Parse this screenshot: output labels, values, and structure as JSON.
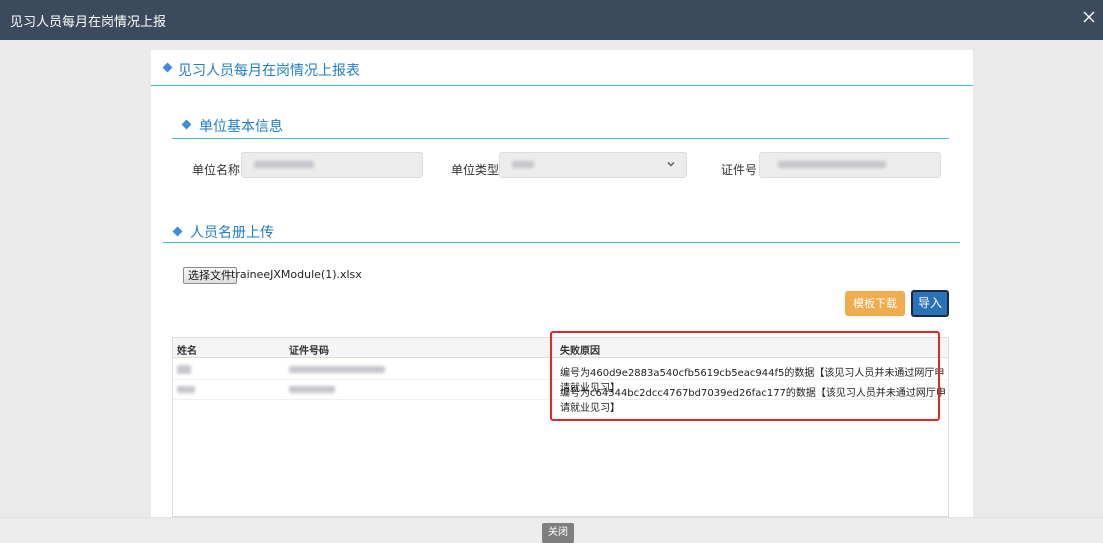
{
  "window": {
    "title": "见习人员每月在岗情况上报"
  },
  "panel": {
    "title": "见习人员每月在岗情况上报表"
  },
  "unit_info": {
    "section_title": "单位基本信息",
    "name_label": "单位名称",
    "type_label": "单位类型",
    "cert_label": "证件号"
  },
  "roster": {
    "section_title": "人员名册上传",
    "choose_file_label": "选择文件",
    "file_name": "traineeJXModule(1).xlsx",
    "template_download_label": "模板下载",
    "import_label": "导入"
  },
  "table": {
    "headers": [
      "姓名",
      "证件号码",
      "失败原因"
    ],
    "rows": [
      {
        "reason": "编号为460d9e2883a540cfb5619cb5eac944f5的数据【该见习人员并未通过网厅申请就业见习】"
      },
      {
        "reason": "编号为c64544bc2dcc4767bd7039ed26fac177的数据【该见习人员并未通过网厅申请就业见习】"
      }
    ]
  },
  "footer": {
    "close_label": "关闭"
  },
  "colors": {
    "titlebar": "#3b4a5c",
    "accent": "#1f7ec7",
    "highlight": "#e02a2a",
    "template_button": "#f0ad4e",
    "import_button": "#2a72b8"
  }
}
